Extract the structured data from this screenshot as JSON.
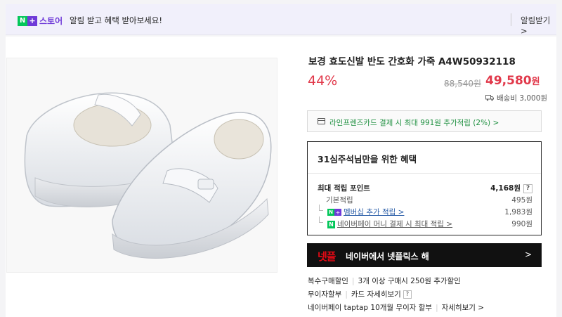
{
  "topbar": {
    "badge_n": "N",
    "badge_plus": "+",
    "store_label": "스토어",
    "message": "알림 받고 혜택 받아보세요!",
    "alarm_label": "알림받기 >"
  },
  "product": {
    "title": "보경 효도신발 반도 간호화 가죽 A4W50932118",
    "discount": "44%",
    "original_price": "88,540원",
    "sale_price": "49,580",
    "sale_currency": "원",
    "shipping": "배송비 3,000원"
  },
  "card_offer": {
    "text": "라인프렌즈카드 결제 시 최대 991원 추가적립 (2%) >"
  },
  "benefits": {
    "title": "31심주석님만을 위한 혜택",
    "max_points_label": "최대 적립 포인트",
    "max_points_value": "4,168원",
    "help_glyph": "?",
    "rows": [
      {
        "label": "기본적립",
        "value": "495원"
      },
      {
        "label": "멤버십 추가 적립 >",
        "value": "1,983원"
      },
      {
        "label": "네이버페이 머니 결제 시 최대 적립 >",
        "value": "990원"
      }
    ]
  },
  "netflix": {
    "logo": "넷플",
    "text": "네이버에서 넷플릭스 해",
    "arrow": ">"
  },
  "footer": {
    "multi_discount": "복수구매할인",
    "multi_discount_detail": "3개 이상 구매시 250원 추가할인",
    "interest_free": "무이자할부",
    "card_detail": "카드 자세히보기",
    "taptap": "네이버페이 taptap 10개월 무이자 할부",
    "taptap_detail": "자세히보기 >"
  },
  "colors": {
    "accent_red": "#e1384a",
    "naver_green": "#03c75a",
    "store_purple": "#6f3ad8"
  }
}
